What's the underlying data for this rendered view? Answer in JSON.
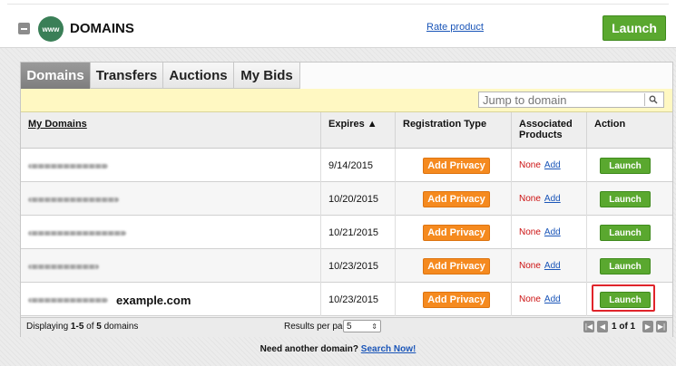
{
  "header": {
    "logo_text": "www",
    "title": "DOMAINS",
    "rate_link": "Rate product",
    "launch_label": "Launch"
  },
  "tabs": [
    {
      "label": "Domains",
      "active": true
    },
    {
      "label": "Transfers",
      "active": false
    },
    {
      "label": "Auctions",
      "active": false
    },
    {
      "label": "My Bids",
      "active": false
    }
  ],
  "search": {
    "placeholder": "Jump to domain"
  },
  "table": {
    "columns": {
      "domains": "My Domains",
      "expires": "Expires ▲",
      "reg_type": "Registration Type",
      "assoc_1": "Associated",
      "assoc_2": "Products",
      "action": "Action"
    },
    "rows": [
      {
        "visible_name": "",
        "expires": "9/14/2015",
        "privacy": "Add Privacy",
        "none": "None",
        "add": "Add",
        "launch": "Launch"
      },
      {
        "visible_name": "",
        "expires": "10/20/2015",
        "privacy": "Add Privacy",
        "none": "None",
        "add": "Add",
        "launch": "Launch"
      },
      {
        "visible_name": "",
        "expires": "10/21/2015",
        "privacy": "Add Privacy",
        "none": "None",
        "add": "Add",
        "launch": "Launch"
      },
      {
        "visible_name": "",
        "expires": "10/23/2015",
        "privacy": "Add Privacy",
        "none": "None",
        "add": "Add",
        "launch": "Launch"
      },
      {
        "visible_name": "example.com",
        "expires": "10/23/2015",
        "privacy": "Add Privacy",
        "none": "None",
        "add": "Add",
        "launch": "Launch"
      }
    ]
  },
  "pager": {
    "display_prefix": "Displaying ",
    "display_range": "1-5",
    "display_mid": " of ",
    "display_total": "5",
    "display_suffix": " domains",
    "rpp_label": "Results per page:",
    "rpp_value": "5",
    "page_text": "1 of 1"
  },
  "footer": {
    "prompt": "Need another domain?",
    "link": "Search Now!"
  },
  "colors": {
    "launch_green": "#5aa82f",
    "privacy_orange": "#f58a1f",
    "search_bar_yellow": "#fff8c2",
    "link_blue": "#1a55b8",
    "none_red": "#cc1111",
    "highlight_red": "#e0242a"
  }
}
